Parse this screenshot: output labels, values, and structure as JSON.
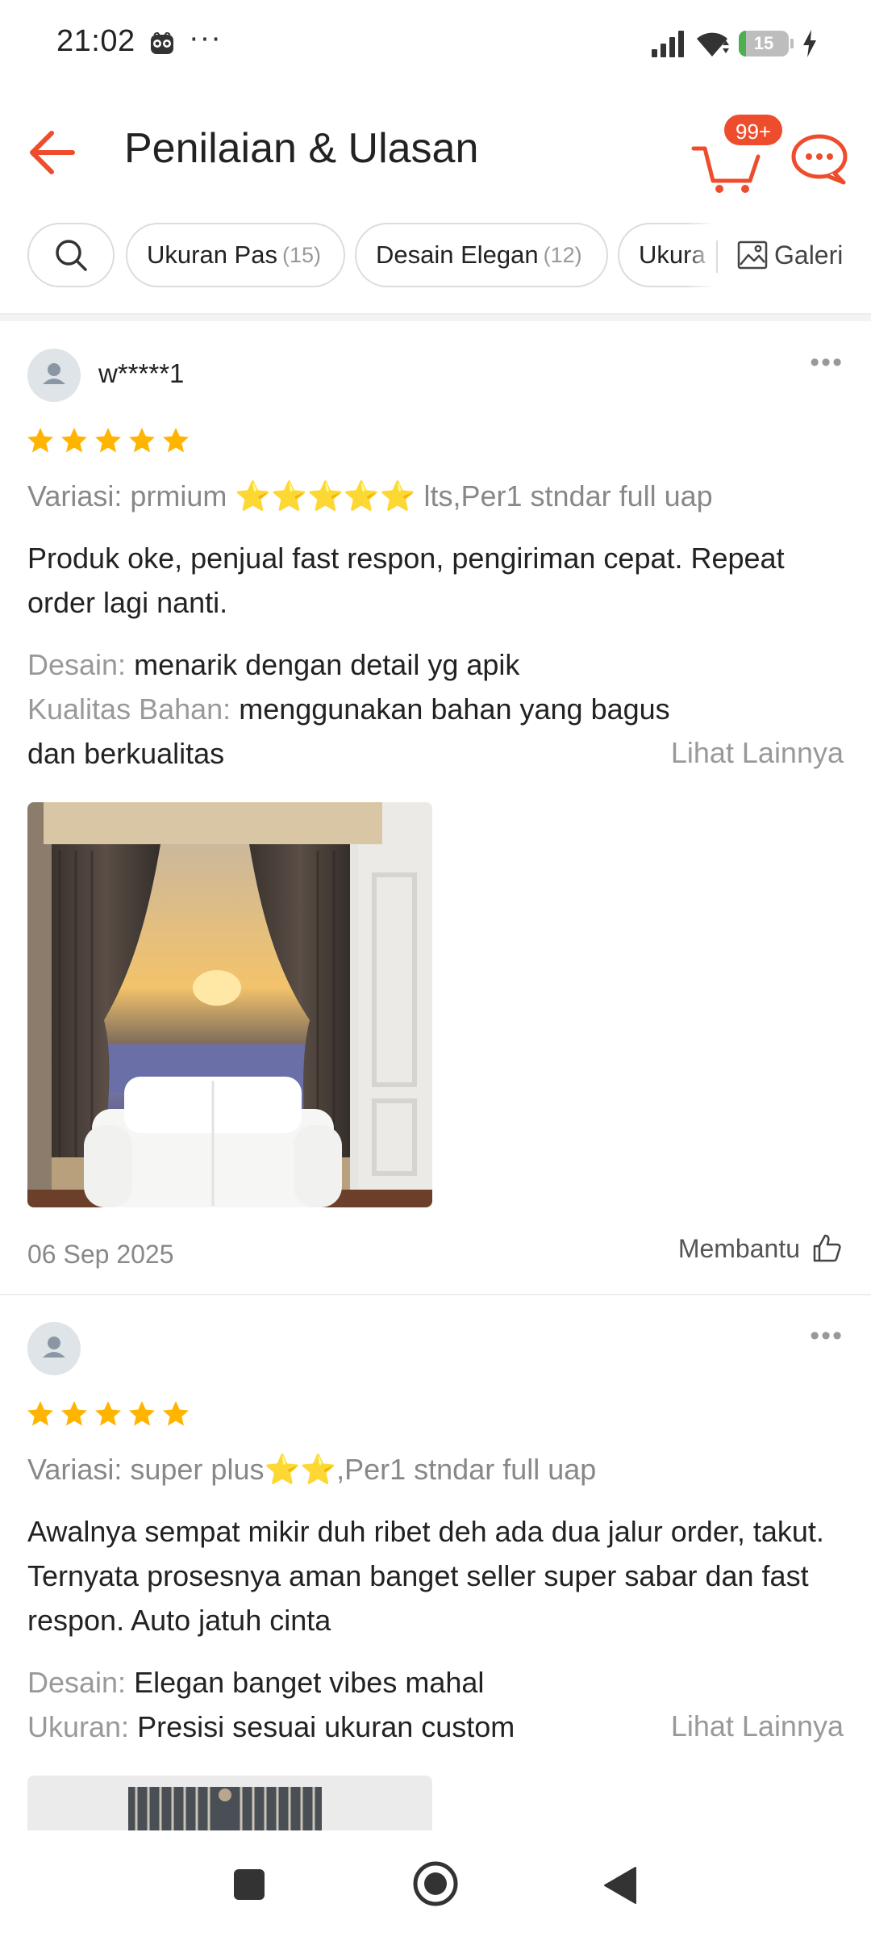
{
  "status_bar": {
    "time": "21:02",
    "more": "···",
    "battery_level": "15",
    "battery_fraction": 0.15,
    "icons": [
      "owl-icon",
      "signal-icon",
      "wifi-icon",
      "battery-icon",
      "charging-icon"
    ]
  },
  "header": {
    "title": "Penilaian & Ulasan",
    "cart_badge": "99+",
    "icons": [
      "back-arrow-icon",
      "cart-icon",
      "chat-icon"
    ]
  },
  "filters": {
    "chips": [
      {
        "label": "Ukuran Pas",
        "count": "(15)"
      },
      {
        "label": "Desain Elegan",
        "count": "(12)"
      },
      {
        "label": "Ukura",
        "count": ""
      }
    ],
    "gallery_label": "Galeri"
  },
  "reviews": [
    {
      "username": "w*****1",
      "rating": 5,
      "variation": "Variasi: prmium ⭐⭐⭐⭐⭐ lts,Per1 stndar full uap",
      "body": "Produk oke, penjual fast respon, pengiriman cepat. Repeat order lagi nanti.",
      "attributes": [
        {
          "key": "Desain:",
          "value": "menarik dengan detail yg apik"
        },
        {
          "key": "Kualitas Bahan:",
          "value": "menggunakan bahan yang bagus dan berkualitas"
        }
      ],
      "see_more": "Lihat Lainnya",
      "date": "06 Sep 2025",
      "helpful": "Membantu"
    },
    {
      "username": "",
      "rating": 5,
      "variation": "Variasi: super plus⭐⭐,Per1 stndar full uap",
      "body": "Awalnya sempat mikir duh ribet deh ada dua jalur order, takut. Ternyata prosesnya aman banget seller super sabar dan fast respon. Auto jatuh cinta",
      "attributes": [
        {
          "key": "Desain:",
          "value": "Elegan banget vibes mahal"
        },
        {
          "key": "Ukuran:",
          "value": "Presisi sesuai ukuran custom"
        }
      ],
      "see_more": "Lihat Lainnya"
    }
  ],
  "colors": {
    "accent": "#ee4d2d",
    "star": "#ffb400",
    "muted_text": "#999999"
  }
}
